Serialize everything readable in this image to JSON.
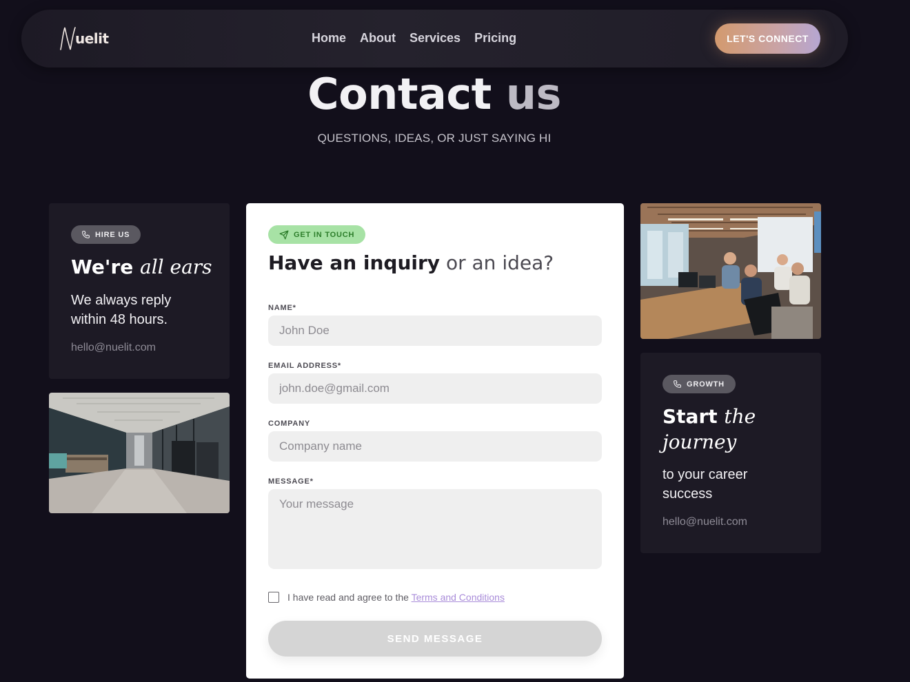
{
  "nav": {
    "logo_text": "uelit",
    "links": [
      "Home",
      "About",
      "Services",
      "Pricing"
    ],
    "cta_label": "LET'S CONNECT"
  },
  "hero": {
    "title_word1": "Contact",
    "title_word2": "us",
    "subtitle": "QUESTIONS, IDEAS, OR JUST SAYING HI"
  },
  "left_card": {
    "badge": "HIRE US",
    "badge_icon": "phone-icon",
    "heading_plain": "We're",
    "heading_italic": "all ears",
    "body_line1": "We always reply",
    "body_line2": "within 48 hours.",
    "email": "hello@nuelit.com"
  },
  "right_card": {
    "badge": "GROWTH",
    "badge_icon": "phone-icon",
    "heading_plain": "Start",
    "heading_italic_1": "the",
    "heading_italic_2": "journey",
    "body_line1": "to your career",
    "body_line2": "success",
    "email": "hello@nuelit.com"
  },
  "form": {
    "tag": "GET IN TOUCH",
    "tag_icon": "send-icon",
    "title_bold": "Have an inquiry",
    "title_light": "or an idea?",
    "fields": {
      "name_label": "NAME*",
      "name_placeholder": "John Doe",
      "email_label": "EMAIL ADDRESS*",
      "email_placeholder": "john.doe@gmail.com",
      "company_label": "COMPANY",
      "company_placeholder": "Company name",
      "message_label": "MESSAGE*",
      "message_placeholder": "Your message"
    },
    "agree_text": "I have read and agree to the",
    "terms_link": "Terms and Conditions",
    "submit_label": "SEND MESSAGE"
  },
  "colors": {
    "background": "#120f1b",
    "card": "#1d1a25",
    "cta_gradient_start": "#d39a6e",
    "cta_gradient_end": "#b6a6d2",
    "tag_green": "#a7e2a5",
    "link_purple": "#a98cd9"
  }
}
